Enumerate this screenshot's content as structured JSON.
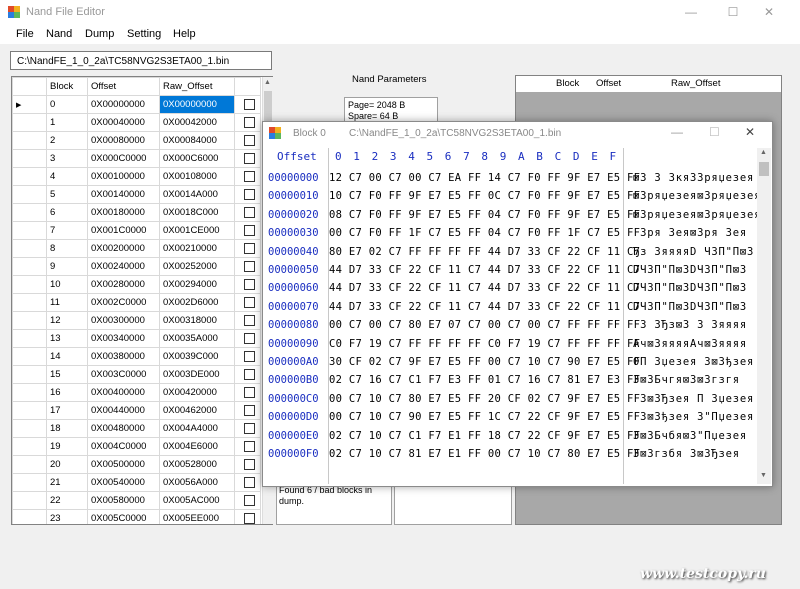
{
  "window": {
    "title": "Nand File Editor",
    "minimize": "—",
    "maximize": "☐",
    "close": "✕"
  },
  "menu": [
    "File",
    "Nand",
    "Dump",
    "Setting",
    "Help"
  ],
  "path": "C:\\NandFE_1_0_2a\\TC58NVG2S3ETA00_1.bin",
  "block_table": {
    "headers": [
      "Block",
      "Offset",
      "Raw_Offset"
    ],
    "selected_index": 0,
    "rows": [
      [
        "0",
        "0X00000000",
        "0X00000000"
      ],
      [
        "1",
        "0X00040000",
        "0X00042000"
      ],
      [
        "2",
        "0X00080000",
        "0X00084000"
      ],
      [
        "3",
        "0X000C0000",
        "0X000C6000"
      ],
      [
        "4",
        "0X00100000",
        "0X00108000"
      ],
      [
        "5",
        "0X00140000",
        "0X0014A000"
      ],
      [
        "6",
        "0X00180000",
        "0X0018C000"
      ],
      [
        "7",
        "0X001C0000",
        "0X001CE000"
      ],
      [
        "8",
        "0X00200000",
        "0X00210000"
      ],
      [
        "9",
        "0X00240000",
        "0X00252000"
      ],
      [
        "10",
        "0X00280000",
        "0X00294000"
      ],
      [
        "11",
        "0X002C0000",
        "0X002D6000"
      ],
      [
        "12",
        "0X00300000",
        "0X00318000"
      ],
      [
        "13",
        "0X00340000",
        "0X0035A000"
      ],
      [
        "14",
        "0X00380000",
        "0X0039C000"
      ],
      [
        "15",
        "0X003C0000",
        "0X003DE000"
      ],
      [
        "16",
        "0X00400000",
        "0X00420000"
      ],
      [
        "17",
        "0X00440000",
        "0X00462000"
      ],
      [
        "18",
        "0X00480000",
        "0X004A4000"
      ],
      [
        "19",
        "0X004C0000",
        "0X004E6000"
      ],
      [
        "20",
        "0X00500000",
        "0X00528000"
      ],
      [
        "21",
        "0X00540000",
        "0X0056A000"
      ],
      [
        "22",
        "0X00580000",
        "0X005AC000"
      ],
      [
        "23",
        "0X005C0000",
        "0X005EE000"
      ]
    ]
  },
  "nand_params": {
    "label": "Nand Parameters",
    "page": "Page= 2048 B",
    "spare": "Spare= 64 B"
  },
  "bad_table": {
    "headers": [
      "Block",
      "Offset",
      "Raw_Offset"
    ]
  },
  "log": "Found 6 / bad blocks in dump.",
  "hex_window": {
    "title": "Block 0",
    "path": "C:\\NandFE_1_0_2a\\TC58NVG2S3ETA00_1.bin",
    "header_offset": "Offset",
    "header_cols": [
      "0",
      "1",
      "2",
      "3",
      "4",
      "5",
      "6",
      "7",
      "8",
      "9",
      "A",
      "B",
      "C",
      "D",
      "E",
      "F"
    ],
    "rows": [
      {
        "offset": "00000000",
        "bytes": "12 C7 00 C7 00 C7 EA FF 14 C7 F0 FF 9F E7 E5 FF",
        "ascii": "⊠З З ЗкяЗЗряџезея"
      },
      {
        "offset": "00000010",
        "bytes": "10 C7 F0 FF 9F E7 E5 FF 0C C7 F0 FF 9F E7 E5 FF",
        "ascii": "⊠Зряџезея⊠Зряџезея"
      },
      {
        "offset": "00000020",
        "bytes": "08 C7 F0 FF 9F E7 E5 FF 04 C7 F0 FF 9F E7 E5 FF",
        "ascii": "⊠Зряџезея⊠Зряџезея"
      },
      {
        "offset": "00000030",
        "bytes": "00 C7 F0 FF 1F C7 E5 FF 04 C7 F0 FF 1F C7 E5 FF",
        "ascii": " Зря Зея⊠Зря Зея"
      },
      {
        "offset": "00000040",
        "bytes": "80 E7 02 C7 FF FF FF FF 44 D7 33 CF 22 CF 11 C7",
        "ascii": "Ђз ЗяяяяD Ч3П\"П⊠З"
      },
      {
        "offset": "00000050",
        "bytes": "44 D7 33 CF 22 CF 11 C7 44 D7 33 CF 22 CF 11 C7",
        "ascii": "DЧ3П\"П⊠ЗDЧ3П\"П⊠З"
      },
      {
        "offset": "00000060",
        "bytes": "44 D7 33 CF 22 CF 11 C7 44 D7 33 CF 22 CF 11 C7",
        "ascii": "DЧ3П\"П⊠ЗDЧ3П\"П⊠З"
      },
      {
        "offset": "00000070",
        "bytes": "44 D7 33 CF 22 CF 11 C7 44 D7 33 CF 22 CF 11 C7",
        "ascii": "DЧ3П\"П⊠ЗDЧ3П\"П⊠З"
      },
      {
        "offset": "00000080",
        "bytes": "00 C7 00 C7 80 E7 07 C7 00 C7 00 C7 FF FF FF FF",
        "ascii": " З ЗЂз⊠З З Зяяяя"
      },
      {
        "offset": "00000090",
        "bytes": "C0 F7 19 C7 FF FF FF FF C0 F7 19 C7 FF FF FF FF",
        "ascii": "Ач⊠ЗяяяяАч⊠Зяяяя"
      },
      {
        "offset": "000000A0",
        "bytes": "30 CF 02 C7 9F E7 E5 FF 00 C7 10 C7 90 E7 E5 FF",
        "ascii": "0П Зџезея З⊠Зђзея"
      },
      {
        "offset": "000000B0",
        "bytes": "02 C7 16 C7 C1 F7 E3 FF 01 C7 16 C7 81 E7 E3 FF",
        "ascii": "З⊠ЗБчгя⊠З⊠Згзгя"
      },
      {
        "offset": "000000C0",
        "bytes": "00 C7 10 C7 80 E7 E5 FF 20 CF 02 C7 9F E7 E5 FF",
        "ascii": " З⊠ЗЂзея П Зџезея"
      },
      {
        "offset": "000000D0",
        "bytes": "00 C7 10 C7 90 E7 E5 FF 1C C7 22 CF 9F E7 E5 FF",
        "ascii": " З⊠Зђзея З\"Пџезея"
      },
      {
        "offset": "000000E0",
        "bytes": "02 C7 10 C7 C1 F7 E1 FF 18 C7 22 CF 9F E7 E5 FF",
        "ascii": "З⊠ЗБчбя⊠З\"Пџезея"
      },
      {
        "offset": "000000F0",
        "bytes": "02 C7 10 C7 81 E7 E1 FF 00 C7 10 C7 80 E7 E5 FF",
        "ascii": "З⊠Згзбя З⊠ЗЂзея"
      }
    ]
  },
  "watermark": "www.testcopy.ru",
  "colors": {
    "accent": "#0078d7",
    "hex_blue": "#1a2ec0"
  }
}
